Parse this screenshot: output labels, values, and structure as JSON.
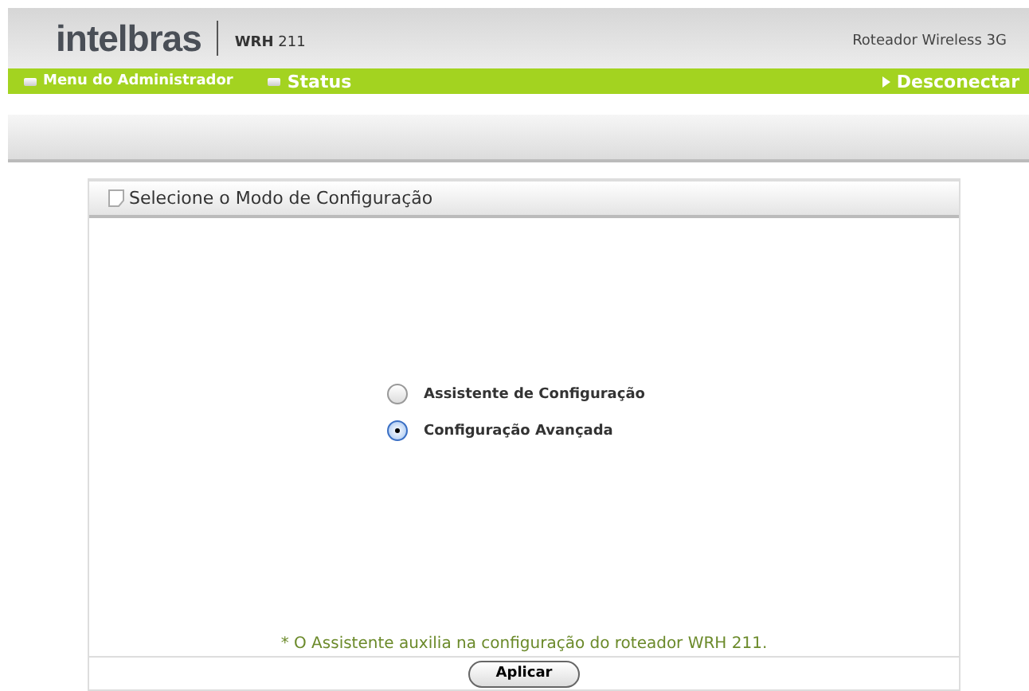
{
  "header": {
    "logo": "intelbras",
    "model_bold": "WRH",
    "model_number": "211",
    "product": "Roteador Wireless 3G"
  },
  "menu": {
    "items": [
      {
        "label": "Menu do Administrador"
      },
      {
        "label": "Status"
      }
    ],
    "logout": "Desconectar"
  },
  "panel": {
    "title": "Selecione o Modo de Configuração",
    "options": [
      {
        "label": "Assistente de Configuração",
        "selected": false
      },
      {
        "label": "Configuração Avançada",
        "selected": true
      }
    ],
    "note": "* O Assistente auxilia na configuração do roteador WRH 211.",
    "button": "Aplicar"
  }
}
